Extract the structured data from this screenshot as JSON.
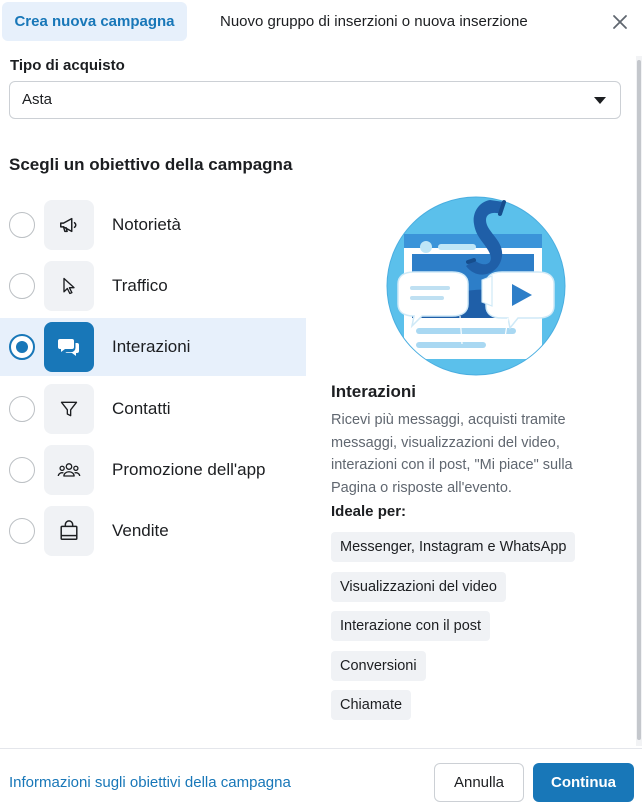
{
  "tabs": {
    "active_label": "Crea nuova campagna",
    "inactive_label": "Nuovo gruppo di inserzioni o nuova inserzione"
  },
  "purchase_type": {
    "label": "Tipo di acquisto",
    "value": "Asta"
  },
  "objectives_title": "Scegli un obiettivo della campagna",
  "objectives": [
    {
      "label": "Notorietà",
      "icon": "megaphone-icon",
      "selected": false
    },
    {
      "label": "Traffico",
      "icon": "cursor-icon",
      "selected": false
    },
    {
      "label": "Interazioni",
      "icon": "chat-bubbles-icon",
      "selected": true
    },
    {
      "label": "Contatti",
      "icon": "funnel-icon",
      "selected": false
    },
    {
      "label": "Promozione dell'app",
      "icon": "people-group-icon",
      "selected": false
    },
    {
      "label": "Vendite",
      "icon": "shopping-bag-icon",
      "selected": false
    }
  ],
  "detail": {
    "title": "Interazioni",
    "description": "Ricevi più messaggi, acquisti tramite messaggi, visualizzazioni del video, interazioni con il post, \"Mi piace\" sulla Pagina o risposte all'evento.",
    "ideal_label": "Ideale per:",
    "chips": [
      "Messenger, Instagram e WhatsApp",
      "Visualizzazioni del video",
      "Interazione con il post",
      "Conversioni",
      "Chiamate"
    ]
  },
  "footer": {
    "link_label": "Informazioni sugli obiettivi della campagna",
    "cancel_label": "Annulla",
    "continue_label": "Continua"
  },
  "colors": {
    "accent": "#1877b8",
    "selected_bg": "#e7f0fb",
    "chip_bg": "#f0f2f5",
    "illustration_bg": "#5bc0eb"
  }
}
